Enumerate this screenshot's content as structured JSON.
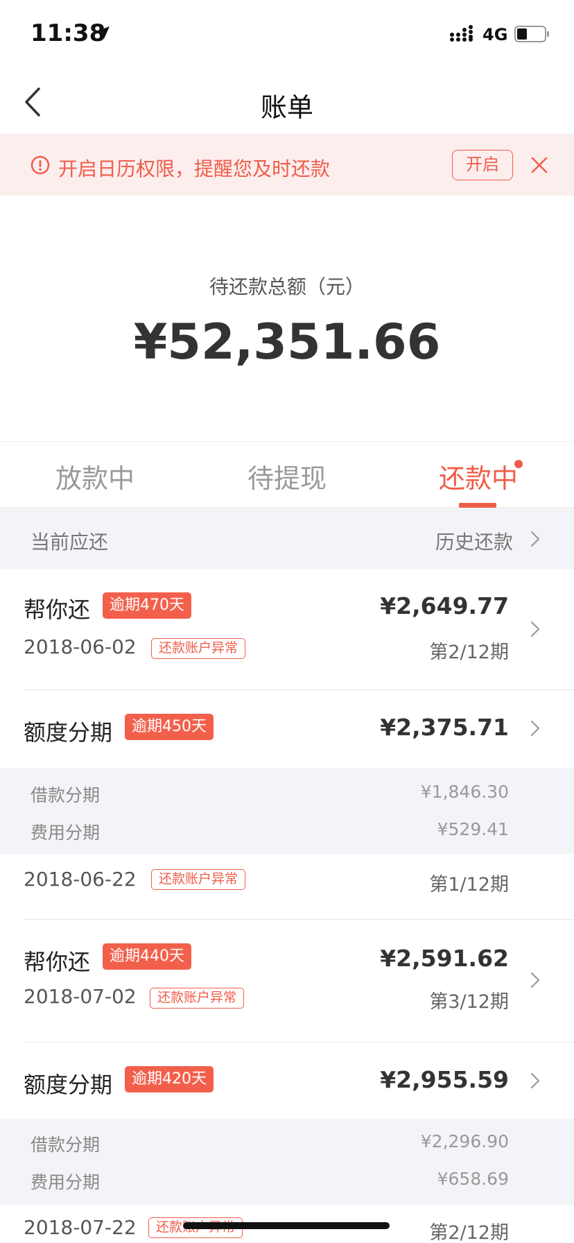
{
  "status": {
    "time": "11:38",
    "network": "4G"
  },
  "nav": {
    "title": "账单"
  },
  "notice": {
    "text": "开启日历权限，提醒您及时还款",
    "button": "开启"
  },
  "summary": {
    "label": "待还款总额（元）",
    "amount": "¥52,351.66"
  },
  "tabs": [
    {
      "label": "放款中"
    },
    {
      "label": "待提现"
    },
    {
      "label": "还款中",
      "active": true
    }
  ],
  "section": {
    "left": "当前应还",
    "right": "历史还款"
  },
  "bills": [
    {
      "title": "帮你还",
      "overdue": "逾期470天",
      "amount": "¥2,649.77",
      "date": "2018-06-02",
      "status": "还款账户异常",
      "period": "第2/12期"
    },
    {
      "title": "额度分期",
      "overdue": "逾期450天",
      "amount": "¥2,375.71",
      "breakdown": [
        {
          "label": "借款分期",
          "value": "¥1,846.30"
        },
        {
          "label": "费用分期",
          "value": "¥529.41"
        }
      ],
      "date": "2018-06-22",
      "status": "还款账户异常",
      "period": "第1/12期"
    },
    {
      "title": "帮你还",
      "overdue": "逾期440天",
      "amount": "¥2,591.62",
      "date": "2018-07-02",
      "status": "还款账户异常",
      "period": "第3/12期"
    },
    {
      "title": "额度分期",
      "overdue": "逾期420天",
      "amount": "¥2,955.59",
      "breakdown": [
        {
          "label": "借款分期",
          "value": "¥2,296.90"
        },
        {
          "label": "费用分期",
          "value": "¥658.69"
        }
      ],
      "date": "2018-07-22",
      "status": "还款账户异常",
      "period": "第2/12期"
    }
  ],
  "colors": {
    "accent": "#ef5d4a",
    "notice_bg": "#fdeeee",
    "section_bg": "#f3f4f7"
  }
}
